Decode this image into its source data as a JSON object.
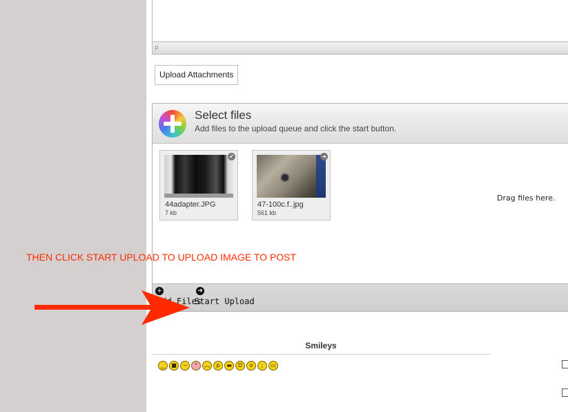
{
  "editor": {
    "status_path": "p"
  },
  "upload_attachments_label": "Upload Attachments",
  "uploader": {
    "title": "Select files",
    "subtitle": "Add files to the upload queue and click the start button.",
    "files": [
      {
        "name": "44adapter.JPG",
        "size": "7 kb",
        "status": "done"
      },
      {
        "name": "47-100c.f..jpg",
        "size": "561 kb",
        "status": "queued"
      }
    ],
    "drag_text": "Drag files here.",
    "add_files_label": "Add Files",
    "start_upload_label": "Start Upload"
  },
  "annotation": {
    "instruction": "THEN CLICK START UPLOAD TO UPLOAD IMAGE TO POST",
    "color": "#ff2a00"
  },
  "smileys": {
    "title": "Smileys",
    "icons": [
      "smile-icon",
      "cool-icon",
      "confused-icon",
      "embarrassed-icon",
      "sad-icon",
      "tongue-icon",
      "grin-icon",
      "big-grin-icon",
      "shocked-icon",
      "wink-icon",
      "frown-icon"
    ]
  },
  "icons": {
    "add": "plus-circle-icon",
    "start": "arrow-right-circle-icon",
    "file_done": "check-icon",
    "file_queued": "arrow-icon"
  }
}
